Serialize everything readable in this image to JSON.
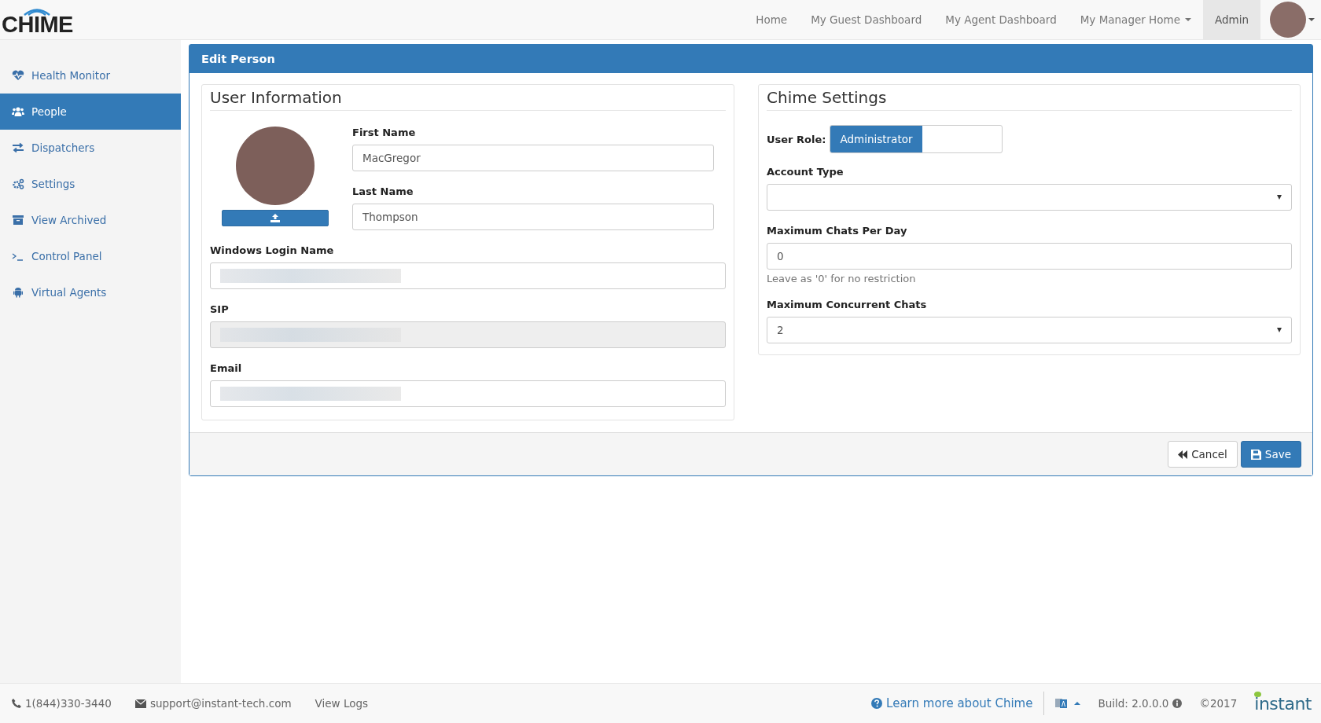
{
  "brand": {
    "logo": "CHIME"
  },
  "navbar": {
    "items": [
      {
        "label": "Home",
        "selected": false,
        "dropdown": false
      },
      {
        "label": "My Guest Dashboard",
        "selected": false,
        "dropdown": false
      },
      {
        "label": "My Agent Dashboard",
        "selected": false,
        "dropdown": false
      },
      {
        "label": "My Manager Home",
        "selected": false,
        "dropdown": true
      },
      {
        "label": "Admin",
        "selected": true,
        "dropdown": false
      }
    ]
  },
  "sidebar": {
    "items": [
      {
        "label": "Health Monitor",
        "selected": false
      },
      {
        "label": "People",
        "selected": true
      },
      {
        "label": "Dispatchers",
        "selected": false
      },
      {
        "label": "Settings",
        "selected": false
      },
      {
        "label": "View Archived",
        "selected": false
      },
      {
        "label": "Control Panel",
        "selected": false
      },
      {
        "label": "Virtual Agents",
        "selected": false
      }
    ]
  },
  "panel": {
    "title": "Edit Person",
    "user_information": {
      "legend": "User Information",
      "first_name": {
        "label": "First Name",
        "value": "MacGregor"
      },
      "last_name": {
        "label": "Last Name",
        "value": "Thompson"
      },
      "windows_login": {
        "label": "Windows Login Name",
        "redacted": true
      },
      "sip": {
        "label": "SIP",
        "redacted": true,
        "disabled": true
      },
      "email": {
        "label": "Email",
        "redacted": true
      }
    },
    "chime_settings": {
      "legend": "Chime Settings",
      "user_role": {
        "label": "User Role:",
        "value": "Administrator"
      },
      "account_type": {
        "label": "Account Type"
      },
      "max_chats_per_day": {
        "label": "Maximum Chats Per Day",
        "value": "0",
        "help": "Leave as '0' for no restriction"
      },
      "max_concurrent_chats": {
        "label": "Maximum Concurrent Chats",
        "value": "2"
      }
    },
    "buttons": [
      {
        "label": "Cancel",
        "kind": "default"
      },
      {
        "label": "Save",
        "kind": "primary"
      }
    ]
  },
  "footer": {
    "phone": "1(844)330-3440",
    "email": "support@instant-tech.com",
    "view_logs": "View Logs",
    "learn_more": "Learn more about Chime",
    "build": "Build: 2.0.0.0",
    "copyright": "©2017",
    "logo": "instant"
  }
}
